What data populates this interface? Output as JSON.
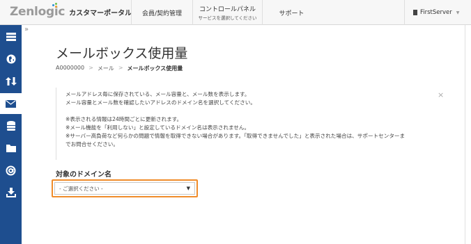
{
  "header": {
    "brand_logo": "Zenlogic",
    "brand_portal": "カスタマーポータル",
    "nav": [
      {
        "label": "会員/契約管理",
        "sub": ""
      },
      {
        "label": "コントロールパネル",
        "sub": "サービスを選択してください"
      },
      {
        "label": "サポート",
        "sub": ""
      }
    ],
    "account_label": "FirstServer",
    "account_caret": "▼"
  },
  "sidebar": {
    "items": [
      {
        "icon": "list-icon",
        "active": false
      },
      {
        "icon": "globe-icon",
        "active": false
      },
      {
        "icon": "transfer-arrows-icon",
        "active": false
      },
      {
        "icon": "mail-icon",
        "active": true
      },
      {
        "icon": "database-icon",
        "active": false
      },
      {
        "icon": "folder-icon",
        "active": false
      },
      {
        "icon": "at-sign-icon",
        "active": false
      },
      {
        "icon": "download-icon",
        "active": false
      }
    ],
    "collapse_label": "»",
    "bg_color": "#1e4e8f"
  },
  "page": {
    "title": "メールボックス使用量",
    "breadcrumb": [
      "A0000000",
      "メール",
      "メールボックス使用量"
    ],
    "breadcrumb_sep": ">"
  },
  "notice": {
    "lines_1": [
      "メールアドレス毎に保存されている、メール容量と、メール数を表示します。",
      "メール容量とメール数を確認したいアドレスのドメイン名を選択してください。"
    ],
    "lines_2": [
      "※表示される情報は24時間ごとに更新されます。",
      "※メール機能を「利用しない」と設定しているドメイン名は表示されません。",
      "※サーバー高負荷など何らかの問題で情報を取得できない場合があります。「取得できませんでした」と表示された場合は、サポートセンターま",
      "でお問合せください。"
    ],
    "close_label": "×"
  },
  "domain_select": {
    "label": "対象のドメイン名",
    "selected": "- ご選択ください -",
    "highlight_color": "#f08c2a"
  }
}
